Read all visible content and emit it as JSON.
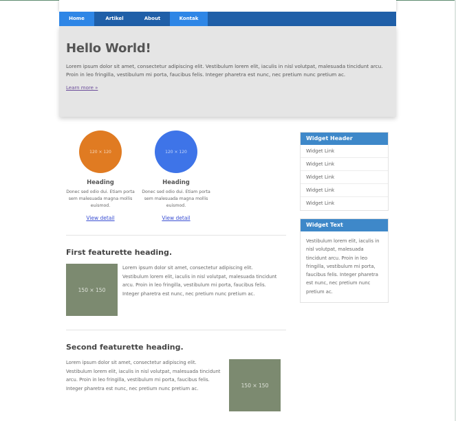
{
  "nav": {
    "items": [
      {
        "label": "Home"
      },
      {
        "label": "Artikel"
      },
      {
        "label": "About"
      },
      {
        "label": "Kontak"
      }
    ]
  },
  "hero": {
    "title": "Hello World!",
    "body": "Lorem ipsum dolor sit amet, consectetur adipiscing elit. Vestibulum lorem elit, iaculis in nisl volutpat, malesuada tincidunt arcu. Proin in leo fringilla, vestibulum mi porta, faucibus felis. Integer pharetra est nunc, nec pretium nunc pretium ac.",
    "link": "Learn more »"
  },
  "features": [
    {
      "placeholder": "120 × 120",
      "color": "#e07b22",
      "heading": "Heading",
      "text": "Donec sed odio dui. Etiam porta sem malesuada magna mollis euismod.",
      "link": "View detail"
    },
    {
      "placeholder": "120 × 120",
      "color": "#3e74e8",
      "heading": "Heading",
      "text": "Donec sed odio dui. Etiam porta sem malesuada magna mollis euismod.",
      "link": "View detail"
    }
  ],
  "featurettes": [
    {
      "title": "First featurette heading.",
      "image": "150 × 150",
      "text": "Lorem ipsum dolor sit amet, consectetur adipiscing elit. Vestibulum lorem elit, iaculis in nisl volutpat, malesuada tincidunt arcu. Proin in leo fringilla, vestibulum mi porta, faucibus felis. Integer pharetra est nunc, nec pretium nunc pretium ac."
    },
    {
      "title": "Second featurette heading.",
      "image": "150 × 150",
      "text": "Lorem ipsum dolor sit amet, consectetur adipiscing elit. Vestibulum lorem elit, iaculis in nisl volutpat, malesuada tincidunt arcu. Proin in leo fringilla, vestibulum mi porta, faucibus felis. Integer pharetra est nunc, nec pretium nunc pretium ac."
    }
  ],
  "widget_links": {
    "header": "Widget Header",
    "links": [
      "Widget Link",
      "Widget Link",
      "Widget Link",
      "Widget Link",
      "Widget Link"
    ]
  },
  "widget_text": {
    "header": "Widget Text",
    "body": "Vestibulum lorem elit, iaculis in nisl volutpat, malesuada tincidunt arcu. Proin in leo fringilla, vestibulum mi porta, faucibus felis. Integer pharetra est nunc, nec pretium nunc pretium ac."
  },
  "colors": {
    "nav_bg": "#1f5fa8",
    "nav_active": "#2e86e6",
    "widget_header": "#3e88c9",
    "featurette_image": "#7c8a70"
  }
}
